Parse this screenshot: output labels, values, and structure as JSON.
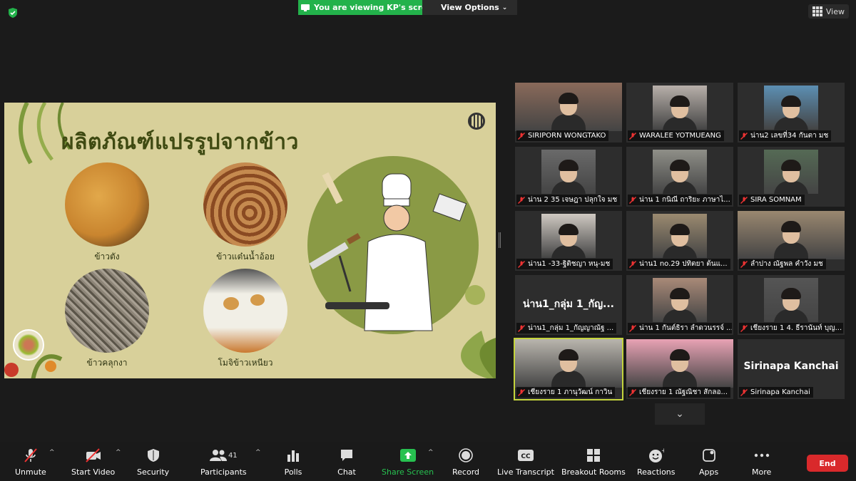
{
  "top": {
    "viewing_banner": "You are viewing KP's screen",
    "view_options": "View Options",
    "view_button": "View"
  },
  "slide": {
    "title": "ผลิตภัณฑ์แปรรูปจากข้าว",
    "foods": [
      {
        "label": "ข้าวตัง",
        "color_a": "#c9852f",
        "color_b": "#e2a84a"
      },
      {
        "label": "ข้าวแต๋นน้ำอ้อย",
        "color_a": "#8a4a22",
        "color_b": "#c58a4f"
      },
      {
        "label": "ข้าวคลุกงา",
        "color_a": "#5a5448",
        "color_b": "#a79f92"
      },
      {
        "label": "โมจิข้าวเหนียว",
        "color_a": "#f1efe6",
        "color_b": "#c9782f"
      }
    ]
  },
  "participants": [
    {
      "name": "SIRIPORN WONGTAKO",
      "kind": "video"
    },
    {
      "name": "WARALEE YOTMUEANG",
      "kind": "video"
    },
    {
      "name": "น่าน2 เลขที่34 กันตา มช",
      "kind": "video"
    },
    {
      "name": "น่าน 2 35 เจษฎา ปลุกใจ มช",
      "kind": "video"
    },
    {
      "name": "น่าน 1 กนิณี ถาริยะ ภาษาไ...",
      "kind": "video"
    },
    {
      "name": "SIRA SOMNAM",
      "kind": "video"
    },
    {
      "name": "น่าน1 -33-ฐิติชญา หนุ-มช",
      "kind": "video"
    },
    {
      "name": "น่าน1 no.29 ปทิตยา ต้นแ...",
      "kind": "video"
    },
    {
      "name": "ลำปาง ณัฐพล คำวัง มช",
      "kind": "video"
    },
    {
      "name": "น่าน1_กลุ่ม 1_กัญญาณัฐ ...",
      "kind": "text",
      "big": "น่าน1_กลุ่ม 1_กัญ..."
    },
    {
      "name": "น่าน 1 กันต์ธิรา ลำดวนรรจ์ ...",
      "kind": "video"
    },
    {
      "name": "เชียงราย 1 4. ธีรานันท์ บุญ...",
      "kind": "video"
    },
    {
      "name": "เชียงราย 1 ภานุวัฒน์ กาวิน",
      "kind": "video",
      "active": true
    },
    {
      "name": "เชียงราย 1 ณัฐณิชา สักลอ...",
      "kind": "video"
    },
    {
      "name": "Sirinapa Kanchai",
      "kind": "text",
      "big": "Sirinapa Kanchai"
    }
  ],
  "toolbar": {
    "unmute": "Unmute",
    "start_video": "Start Video",
    "security": "Security",
    "participants": "Participants",
    "participants_count": "41",
    "polls": "Polls",
    "chat": "Chat",
    "share_screen": "Share Screen",
    "record": "Record",
    "live_transcript": "Live Transcript",
    "breakout_rooms": "Breakout Rooms",
    "reactions": "Reactions",
    "apps": "Apps",
    "more": "More",
    "end": "End"
  },
  "colors": {
    "accent_green": "#23b24b",
    "end_red": "#d9292b",
    "slide_bg": "#d8d09a",
    "active_speaker": "#c4d43c"
  }
}
